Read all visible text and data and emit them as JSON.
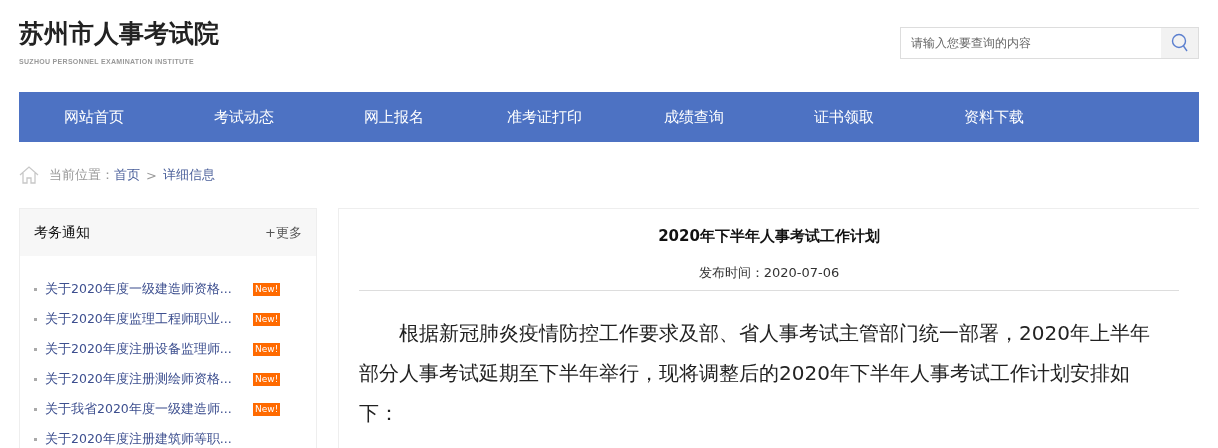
{
  "logo": {
    "title": "苏州市人事考试院",
    "subtitle": "SUZHOU PERSONNEL EXAMINATION INSTITUTE"
  },
  "search": {
    "placeholder": "请输入您要查询的内容"
  },
  "nav": [
    "网站首页",
    "考试动态",
    "网上报名",
    "准考证打印",
    "成绩查询",
    "证书领取",
    "资料下载"
  ],
  "breadcrumb": {
    "label": "当前位置：",
    "items": [
      "首页",
      "详细信息"
    ],
    "separator": ">"
  },
  "sidebar": {
    "title": "考务通知",
    "more": "+更多",
    "items": [
      {
        "text": "关于2020年度一级建造师资格...",
        "badge": "New!"
      },
      {
        "text": "关于2020年度监理工程师职业...",
        "badge": "New!"
      },
      {
        "text": "关于2020年度注册设备监理师...",
        "badge": "New!"
      },
      {
        "text": "关于2020年度注册测绘师资格...",
        "badge": "New!"
      },
      {
        "text": "关于我省2020年度一级建造师...",
        "badge": "New!"
      },
      {
        "text": "关于2020年度注册建筑师等职..."
      }
    ]
  },
  "article": {
    "title": "2020年下半年人事考试工作计划",
    "date": "发布时间：2020-07-06",
    "body": "根据新冠肺炎疫情防控工作要求及部、省人事考试主管部门统一部署，2020年上半年部分人事考试延期至下半年举行，现将调整后的2020年下半年人事考试工作计划安排如下："
  }
}
